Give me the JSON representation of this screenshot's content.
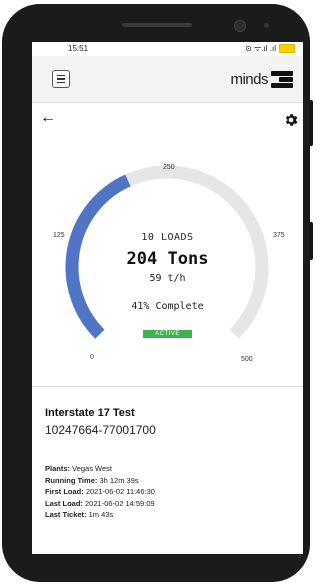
{
  "status_bar": {
    "time": "15:51",
    "signal_text": "⊙ ᯤ.ıl .ıl"
  },
  "brand": {
    "name": "minds"
  },
  "gauge": {
    "ticks": [
      "0",
      "125",
      "250",
      "375",
      "500"
    ],
    "loads": "10 LOADS",
    "tons": "204 Tons",
    "rate": "59 t/h",
    "complete": "41% Complete",
    "status": "ACTIVE",
    "progress_fraction": 0.41,
    "color_fill": "#4f75c4",
    "color_track": "#e6e6e6"
  },
  "job": {
    "title": "Interstate 17 Test",
    "id": "10247664-77001700"
  },
  "details": [
    {
      "label": "Plants:",
      "value": "Vegas West"
    },
    {
      "label": "Running Time:",
      "value": "3h 12m 39s"
    },
    {
      "label": "First Load:",
      "value": "2021-06-02 11:46:30"
    },
    {
      "label": "Last Load:",
      "value": "2021-06-02 14:59:09"
    },
    {
      "label": "Last Ticket:",
      "value": "1m 43s"
    }
  ]
}
